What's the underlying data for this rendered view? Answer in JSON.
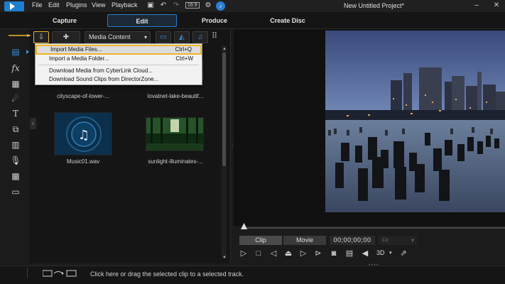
{
  "menubar": {
    "items": [
      "File",
      "Edit",
      "Plugins",
      "View",
      "Playback"
    ],
    "aspect_label": "16:9"
  },
  "project_title": "New Untitled Project*",
  "modes": [
    "Capture",
    "Edit",
    "Produce",
    "Create Disc"
  ],
  "library": {
    "dropdown_label": "Media Content",
    "items": [
      {
        "label": "cityscape-of-lower-...",
        "kind": "video"
      },
      {
        "label": "lovatnet-lake-beautif...",
        "kind": "video"
      },
      {
        "label": "Music01.wav",
        "kind": "audio"
      },
      {
        "label": "sunlight-illuminates-...",
        "kind": "video"
      }
    ]
  },
  "import_menu": {
    "items": [
      {
        "label": "Import Media Files...",
        "shortcut": "Ctrl+Q"
      },
      {
        "label": "Import a Media Folder...",
        "shortcut": "Ctrl+W"
      },
      {
        "label": "Download Media from CyberLink Cloud...",
        "shortcut": ""
      },
      {
        "label": "Download Sound Clips from DirectorZone...",
        "shortcut": ""
      }
    ]
  },
  "preview": {
    "clip_label": "Clip",
    "movie_label": "Movie",
    "timecode": "00;00;00;00",
    "fit_label": "Fit",
    "mode_3d": "3D"
  },
  "status": {
    "text": "Click here or drag the selected clip to a selected track."
  },
  "colors": {
    "accent": "#2a7ed0",
    "highlight": "#f0b429"
  }
}
